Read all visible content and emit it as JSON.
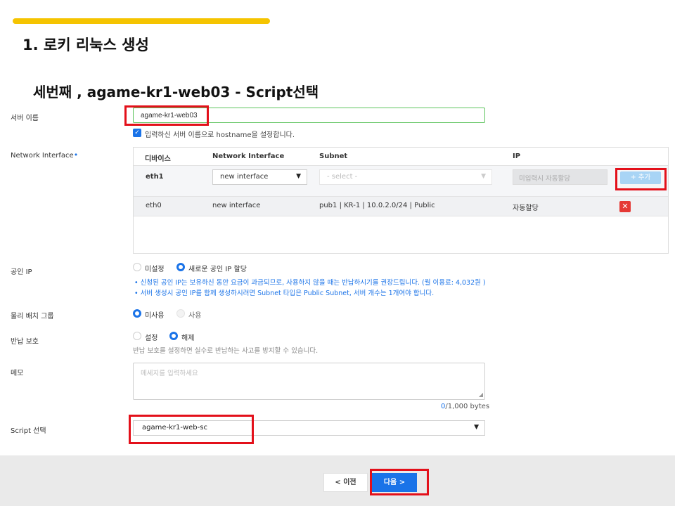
{
  "slide": {
    "title": "1. 로키 리눅스 생성",
    "subtitle": "세번째 , agame-kr1-web03   - Script선택"
  },
  "form": {
    "server_name": {
      "label": "서버 이름",
      "value": "agame-kr1-web03",
      "hostname_checkbox_label": "입력하신 서버 이름으로 hostname을 설정합니다."
    },
    "network_interface": {
      "label": "Network Interface",
      "required_mark": "•",
      "columns": [
        "디바이스",
        "Network Interface",
        "Subnet",
        "IP"
      ],
      "new_row": {
        "device": "eth1",
        "interface": "new interface",
        "subnet_placeholder": "- select -",
        "ip_placeholder": "미입력시 자동할당",
        "add_button": "+ 추가"
      },
      "rows": [
        {
          "device": "eth0",
          "interface": "new interface",
          "subnet": "pub1 | KR-1 | 10.0.2.0/24 | Public",
          "ip": "자동할당",
          "delete": "✕"
        }
      ]
    },
    "public_ip": {
      "label": "공인 IP",
      "options": [
        "미설정",
        "새로운 공인 IP 할당"
      ],
      "selected": "새로운 공인 IP 할당",
      "notes": [
        "•  신청된 공인 IP는 보유하신 동안 요금이 과금되므로, 사용하지 않을 때는 반납하시기를 권장드립니다. (월 이용료: 4,032원 )",
        "•  서버 생성시 공인 IP를 함께 생성하시려면 Subnet 타입은 Public Subnet, 서버 개수는 1개여야 합니다."
      ]
    },
    "placement_group": {
      "label": "물리 배치 그룹",
      "options": [
        "미사용",
        "사용"
      ],
      "selected": "미사용"
    },
    "return_protection": {
      "label": "반납 보호",
      "options": [
        "설정",
        "해제"
      ],
      "selected": "해제",
      "help": "반납 보호를 설정하면 실수로 반납하는 사고를 방지할 수 있습니다."
    },
    "memo": {
      "label": "메모",
      "placeholder": "메세지를 입력하세요",
      "count": "0",
      "limit": "/1,000 bytes"
    },
    "script": {
      "label": "Script 선택",
      "value": "agame-kr1-web-sc"
    }
  },
  "footer": {
    "prev_label": "<  이전",
    "next_label": "다음   >"
  },
  "colors": {
    "accent_bar": "#f5c400",
    "primary": "#1a73e8",
    "highlight_box": "#e3101a",
    "danger": "#e53935"
  }
}
